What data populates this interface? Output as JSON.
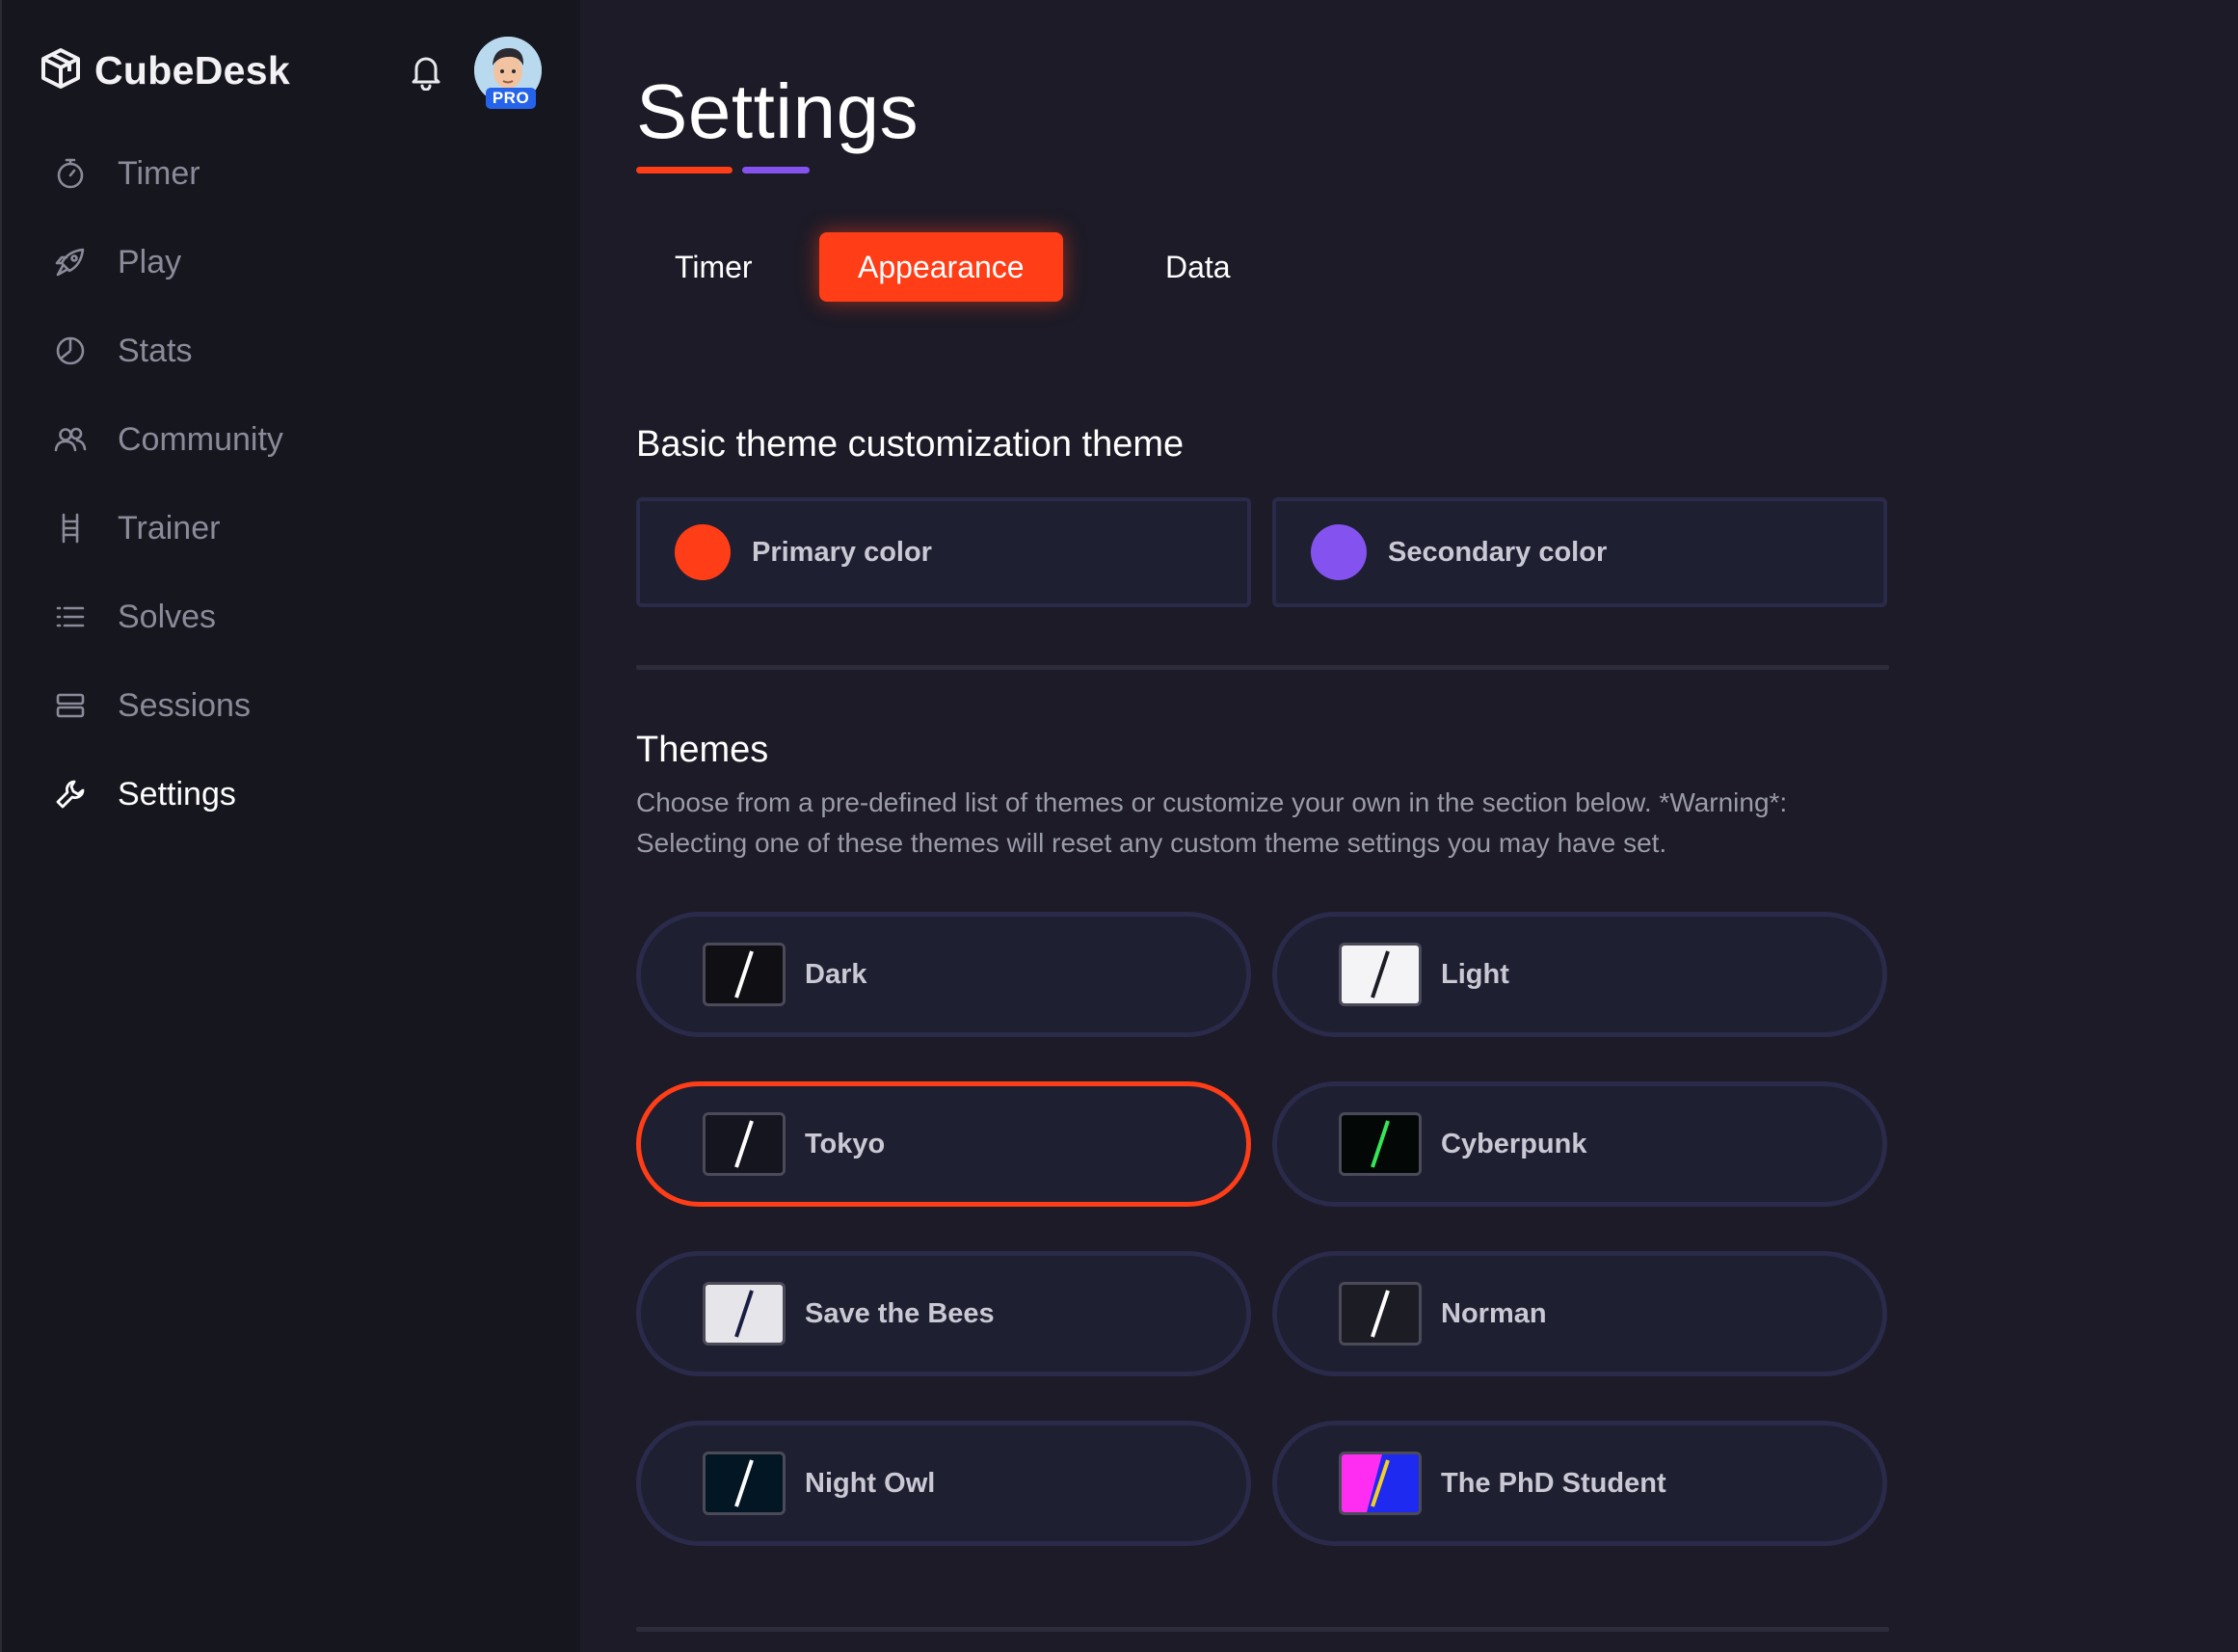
{
  "app": {
    "name": "CubeDesk",
    "pro_badge": "PRO",
    "accent_color": "#ff3d17",
    "secondary_accent_color": "#8453ef"
  },
  "sidebar": {
    "items": [
      {
        "label": "Timer",
        "icon": "stopwatch-icon"
      },
      {
        "label": "Play",
        "icon": "rocket-icon"
      },
      {
        "label": "Stats",
        "icon": "pie-chart-icon"
      },
      {
        "label": "Community",
        "icon": "users-icon"
      },
      {
        "label": "Trainer",
        "icon": "ladder-icon"
      },
      {
        "label": "Solves",
        "icon": "list-icon"
      },
      {
        "label": "Sessions",
        "icon": "stack-icon"
      },
      {
        "label": "Settings",
        "icon": "wrench-icon",
        "active": true
      }
    ]
  },
  "page": {
    "title": "Settings"
  },
  "tabs": [
    {
      "label": "Timer"
    },
    {
      "label": "Appearance",
      "active": true
    },
    {
      "label": "Data"
    }
  ],
  "basic_theme": {
    "title": "Basic theme customization theme",
    "primary": {
      "label": "Primary color",
      "color": "#ff3d17"
    },
    "secondary": {
      "label": "Secondary color",
      "color": "#8453ef"
    }
  },
  "themes": {
    "title": "Themes",
    "description": "Choose from a pre-defined list of themes or customize your own in the section below. *Warning*: Selecting one of these themes will reset any custom theme settings you may have set.",
    "selected": "Tokyo",
    "items": [
      {
        "label": "Dark",
        "bg": "#0f0f14",
        "slash": "#ffffff"
      },
      {
        "label": "Light",
        "bg": "#f4f4f6",
        "slash": "#1c1c24"
      },
      {
        "label": "Tokyo",
        "bg": "#15151f",
        "slash": "#ffffff"
      },
      {
        "label": "Cyberpunk",
        "bg": "#030806",
        "slash": "#35e657"
      },
      {
        "label": "Save the Bees",
        "bg": "#e6e6ea",
        "slash": "#1a1e44"
      },
      {
        "label": "Norman",
        "bg": "#1c1c24",
        "slash": "#ffffff"
      },
      {
        "label": "Night Owl",
        "bg": "#031624",
        "slash": "#ffffff"
      },
      {
        "label": "The PhD Student",
        "bg": "#1e2af0",
        "bg2": "#ff2cf2",
        "slash": "#f5d020"
      }
    ]
  }
}
